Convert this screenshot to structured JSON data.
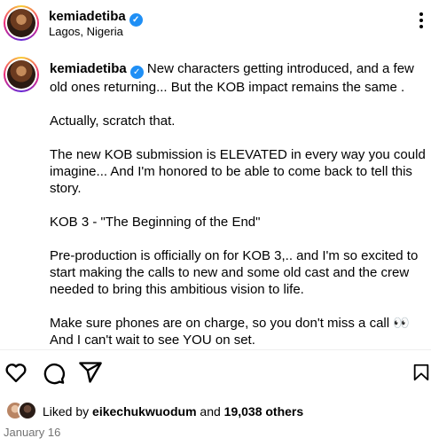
{
  "header": {
    "username": "kemiadetiba",
    "location": "Lagos, Nigeria"
  },
  "caption": {
    "username": "kemiadetiba",
    "paragraphs": [
      "New characters getting introduced, and a few old ones returning... But the KOB impact remains the same .",
      "Actually, scratch that.",
      "The new KOB submission is ELEVATED in every way you could imagine... And I'm honored to be able to come back to tell this story.",
      "KOB 3 - \"The Beginning of the End\"",
      "Pre-production is officially on for KOB 3,.. and I'm so excited to start making the calls to new and some old cast and the crew needed to bring this ambitious vision to life.",
      "Make sure phones are on charge, so you don't miss a call 👀 And I can't wait to see YOU on set."
    ]
  },
  "likes": {
    "prefix": "Liked by",
    "user": "eikechukwuodum",
    "joiner": "and",
    "others": "19,038 others"
  },
  "date": "January 16",
  "icons": [
    "more-icon",
    "verified-icon",
    "heart-icon",
    "comment-icon",
    "share-icon",
    "save-icon"
  ]
}
